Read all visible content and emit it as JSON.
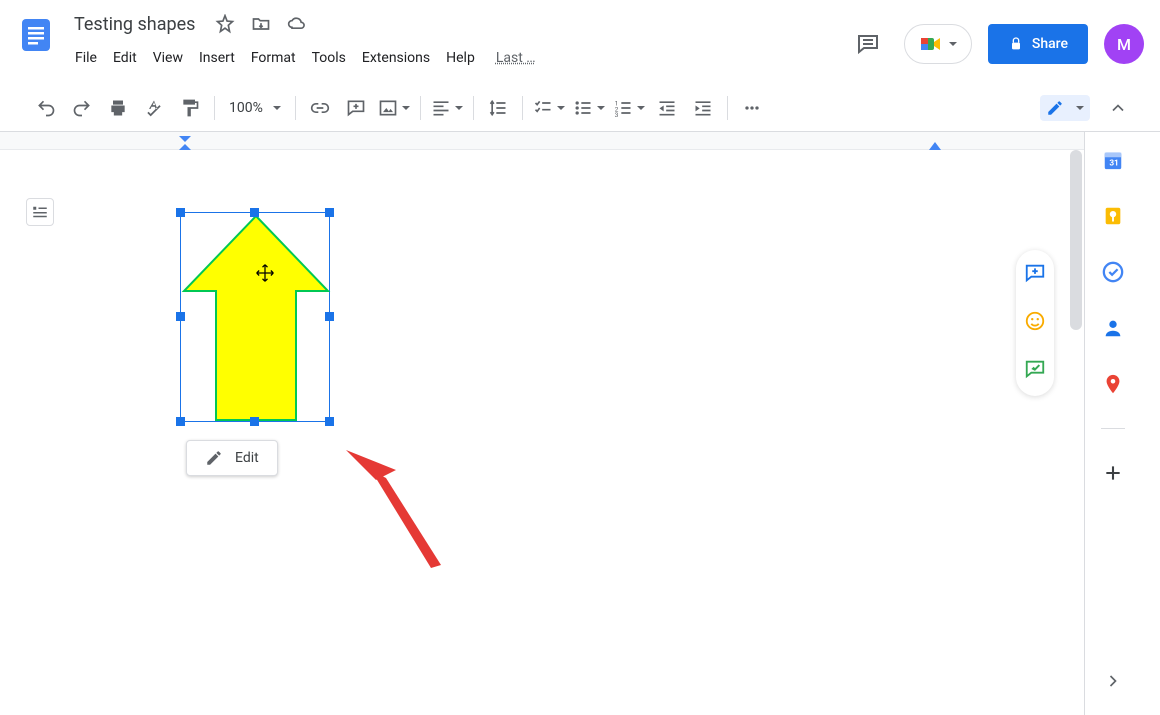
{
  "header": {
    "title": "Testing shapes",
    "last_edit": "Last …",
    "share_label": "Share",
    "avatar_letter": "M"
  },
  "menubar": [
    "File",
    "Edit",
    "View",
    "Insert",
    "Format",
    "Tools",
    "Extensions",
    "Help"
  ],
  "toolbar": {
    "zoom": "100%"
  },
  "shape": {
    "edit_label": "Edit",
    "fill_color": "#ffff00",
    "stroke_color": "#00c853"
  }
}
